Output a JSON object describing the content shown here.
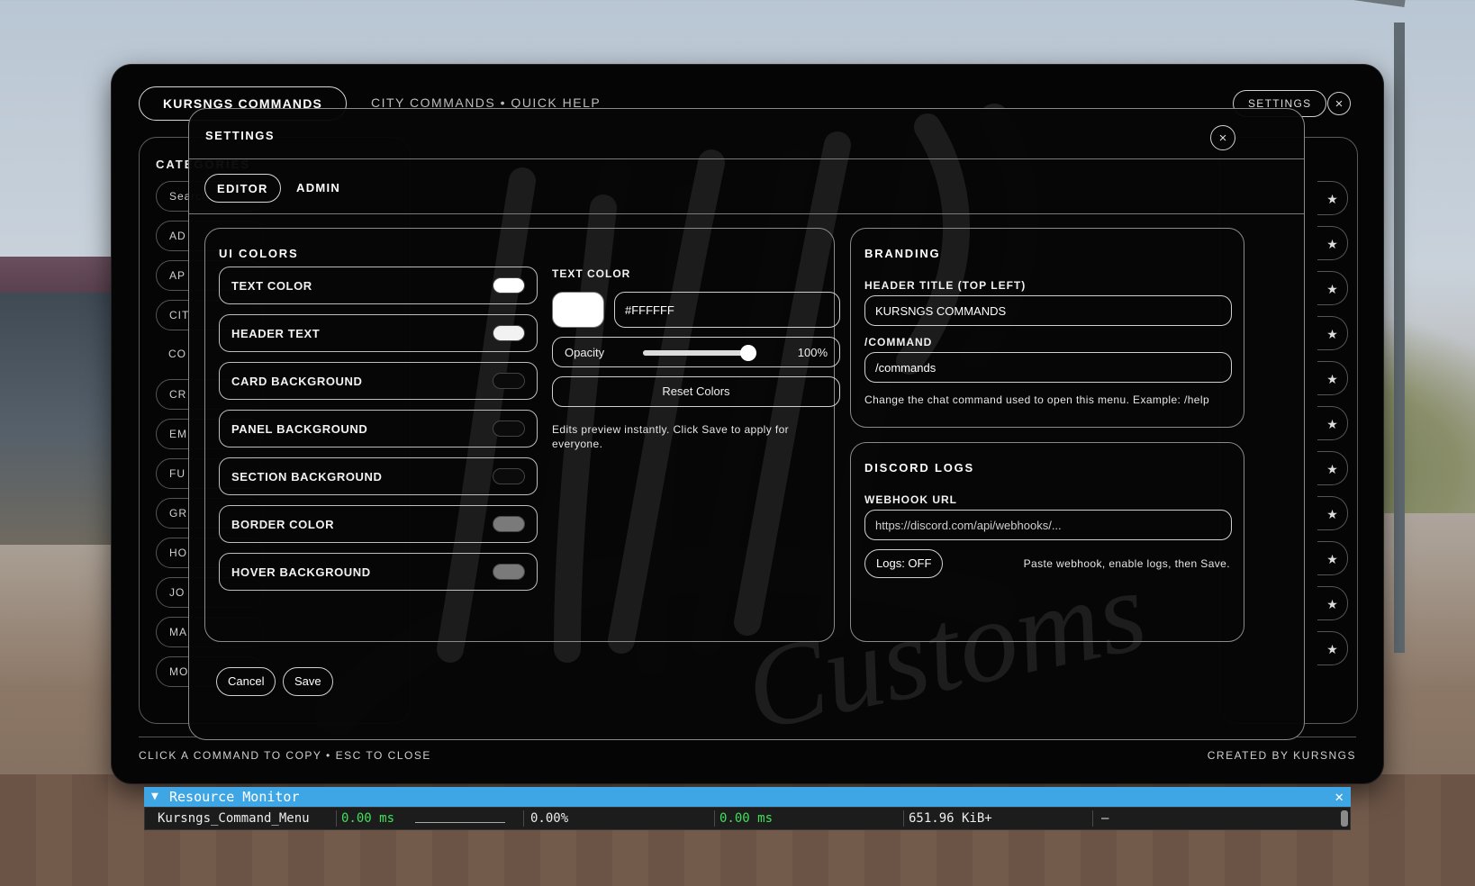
{
  "header": {
    "title": "KURSNGS COMMANDS",
    "subtitle": "CITY COMMANDS • QUICK HELP",
    "settings_label": "SETTINGS",
    "close_glyph": "×"
  },
  "categories": {
    "title": "CATEGORIES",
    "search_placeholder": "Search",
    "items": [
      "AD",
      "AP",
      "CIT",
      "CO",
      "CR",
      "EM",
      "FU",
      "GR",
      "HO",
      "JO",
      "MA",
      "MO"
    ]
  },
  "star_glyph": "★",
  "footer": {
    "left": "CLICK A COMMAND TO COPY • ESC TO CLOSE",
    "right": "CREATED BY KURSNGS"
  },
  "settings_modal": {
    "title": "SETTINGS",
    "close_glyph": "×",
    "tabs": [
      "EDITOR",
      "ADMIN"
    ],
    "ui_colors": {
      "title": "UI COLORS",
      "rows": [
        {
          "label": "TEXT COLOR",
          "swatch": "#FFFFFF"
        },
        {
          "label": "HEADER TEXT",
          "swatch": "#F2F2F2"
        },
        {
          "label": "CARD BACKGROUND",
          "swatch": "#0B0B0B"
        },
        {
          "label": "PANEL BACKGROUND",
          "swatch": "#0B0B0B"
        },
        {
          "label": "SECTION BACKGROUND",
          "swatch": "#0B0B0B"
        },
        {
          "label": "BORDER COLOR",
          "swatch": "#7A7A7A"
        },
        {
          "label": "HOVER BACKGROUND",
          "swatch": "#7A7A7A"
        }
      ],
      "editor": {
        "label": "TEXT COLOR",
        "hex_value": "#FFFFFF",
        "swatch": "#FFFFFF",
        "opacity_label": "Opacity",
        "opacity_percent": 100,
        "opacity_text": "100%",
        "reset_label": "Reset Colors",
        "help": "Edits preview instantly. Click Save to apply for everyone."
      }
    },
    "branding": {
      "title": "BRANDING",
      "header_title_label": "HEADER TITLE (TOP LEFT)",
      "header_title_value": "KURSNGS COMMANDS",
      "command_label": "/COMMAND",
      "command_value": "/commands",
      "help": "Change the chat command used to open this menu. Example: /help"
    },
    "discord_logs": {
      "title": "DISCORD LOGS",
      "webhook_label": "WEBHOOK URL",
      "webhook_placeholder": "https://discord.com/api/webhooks/...",
      "logs_button": "Logs: OFF",
      "help": "Paste webhook, enable logs, then Save."
    },
    "cancel_label": "Cancel",
    "save_label": "Save"
  },
  "watermark": {
    "script_text": "Customs"
  },
  "resource_monitor": {
    "title": "Resource Monitor",
    "collapse_glyph": "▼",
    "close_glyph": "✕",
    "row": {
      "resource": "Kursngs_Command_Menu",
      "cpu_ms": "0.00 ms",
      "cpu_percent": "0.00%",
      "time_ms": "0.00 ms",
      "memory": "651.96 KiB+",
      "extra": "–"
    }
  },
  "colors": {
    "accent_monitor": "#3EA6E4",
    "value_green": "#3FE05A",
    "panel_bg": "#050505"
  }
}
